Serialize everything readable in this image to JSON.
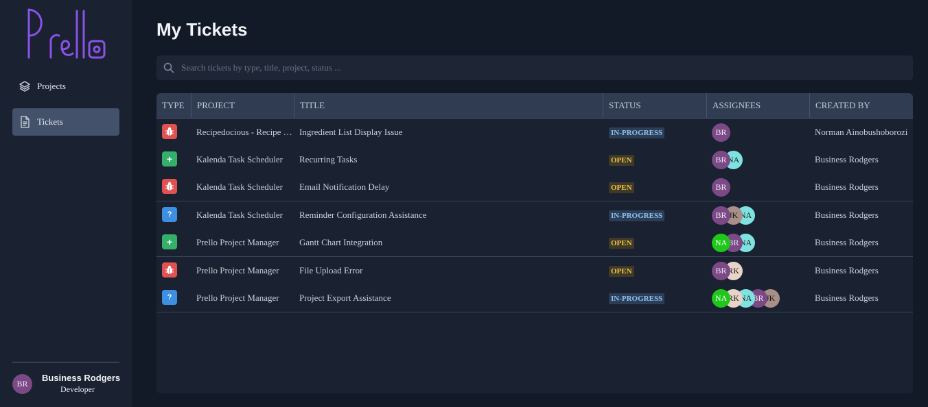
{
  "app": {
    "logo_text": "Prello"
  },
  "sidebar": {
    "items": [
      {
        "label": "Projects",
        "icon": "layers-icon",
        "active": false
      },
      {
        "label": "Tickets",
        "icon": "document-icon",
        "active": true
      }
    ],
    "profile": {
      "initials": "BR",
      "name": "Business Rodgers",
      "role": "Developer",
      "avatar_color": "#7b4a86"
    }
  },
  "main": {
    "title": "My Tickets",
    "search": {
      "placeholder": "Search tickets by type, title, project, status ..."
    },
    "table": {
      "headers": {
        "type": "TYPE",
        "project": "PROJECT",
        "title": "TITLE",
        "status": "STATUS",
        "assignees": "ASSIGNEES",
        "created_by": "CREATED BY"
      },
      "rows": [
        {
          "type": "bug",
          "project": "Recipedocious - Recipe Manager",
          "title": "Ingredient List Display Issue",
          "status": "IN-PROGRESS",
          "assignees": [
            "BR"
          ],
          "created_by": "Norman Ainobushoborozi"
        },
        {
          "type": "feature",
          "project": "Kalenda Task Scheduler",
          "title": "Recurring Tasks",
          "status": "OPEN",
          "assignees": [
            "BR",
            "NA"
          ],
          "created_by": "Business Rodgers"
        },
        {
          "type": "bug",
          "project": "Kalenda Task Scheduler",
          "title": "Email Notification Delay",
          "status": "OPEN",
          "assignees": [
            "BR"
          ],
          "created_by": "Business Rodgers"
        },
        {
          "type": "question",
          "project": "Kalenda Task Scheduler",
          "title": "Reminder Configuration Assistance",
          "status": "IN-PROGRESS",
          "assignees": [
            "BR",
            "JK",
            "NA"
          ],
          "created_by": "Business Rodgers"
        },
        {
          "type": "feature",
          "project": "Prello Project Manager",
          "title": "Gantt Chart Integration",
          "status": "OPEN",
          "assignees": [
            "NA",
            "BR",
            "NA"
          ],
          "created_by": "Business Rodgers"
        },
        {
          "type": "bug",
          "project": "Prello Project Manager",
          "title": "File Upload Error",
          "status": "OPEN",
          "assignees": [
            "BR",
            "RK"
          ],
          "created_by": "Business Rodgers"
        },
        {
          "type": "question",
          "project": "Prello Project Manager",
          "title": "Project Export Assistance",
          "status": "IN-PROGRESS",
          "assignees": [
            "NA",
            "RK",
            "NA",
            "BR",
            "JK"
          ],
          "created_by": "Business Rodgers"
        }
      ]
    }
  },
  "colors": {
    "background": "#131a27",
    "sidebar": "#1a2130",
    "active_nav": "#44516a",
    "bug": "#e05252",
    "feature": "#34b06a",
    "question": "#3d8fe0",
    "logo": "#8b52e8"
  }
}
